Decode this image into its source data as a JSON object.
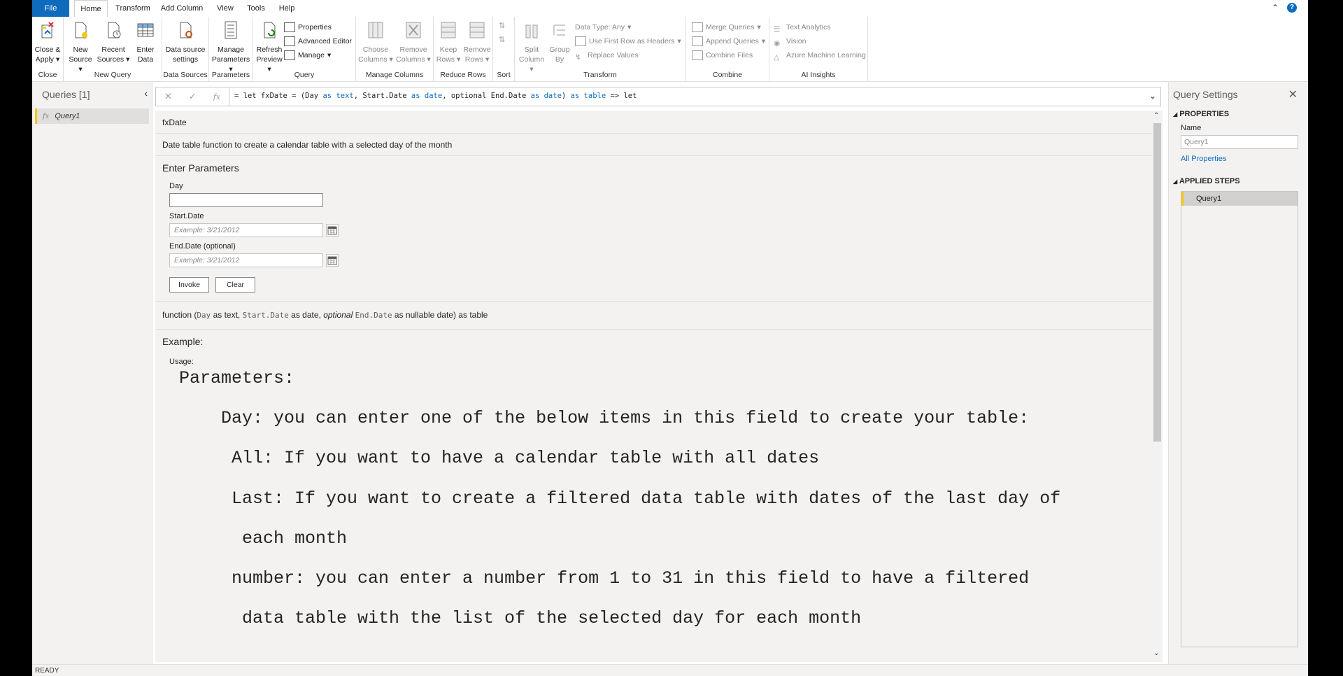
{
  "tabs": [
    "File",
    "Home",
    "Transform",
    "Add Column",
    "View",
    "Tools",
    "Help"
  ],
  "ribbon": {
    "close": {
      "close_apply": [
        "Close &",
        "Apply"
      ],
      "group": "Close"
    },
    "new_query": {
      "new_source": [
        "New",
        "Source"
      ],
      "recent_sources": [
        "Recent",
        "Sources"
      ],
      "enter_data": [
        "Enter",
        "Data"
      ],
      "group": "New Query"
    },
    "data_sources": {
      "settings": [
        "Data source",
        "settings"
      ],
      "group": "Data Sources"
    },
    "parameters": {
      "manage": [
        "Manage",
        "Parameters"
      ],
      "group": "Parameters"
    },
    "query": {
      "refresh": [
        "Refresh",
        "Preview"
      ],
      "properties": "Properties",
      "advanced_editor": "Advanced Editor",
      "manage": "Manage",
      "group": "Query"
    },
    "manage_columns": {
      "choose": [
        "Choose",
        "Columns"
      ],
      "remove": [
        "Remove",
        "Columns"
      ],
      "group": "Manage Columns"
    },
    "reduce_rows": {
      "keep": [
        "Keep",
        "Rows"
      ],
      "remove": [
        "Remove",
        "Rows"
      ],
      "group": "Reduce Rows"
    },
    "sort": {
      "group": "Sort"
    },
    "transform": {
      "split": [
        "Split",
        "Column"
      ],
      "group_by": [
        "Group",
        "By"
      ],
      "data_type": "Data Type: Any",
      "use_first_row": "Use First Row as Headers",
      "replace_values": "Replace Values",
      "group": "Transform"
    },
    "combine": {
      "merge": "Merge Queries",
      "append": "Append Queries",
      "combine_files": "Combine Files",
      "group": "Combine"
    },
    "ai": {
      "text_analytics": "Text Analytics",
      "vision": "Vision",
      "azure_ml": "Azure Machine Learning",
      "group": "AI Insights"
    }
  },
  "queries_pane": {
    "title": "Queries [1]",
    "item": "Query1"
  },
  "formula_bar": {
    "text_parts": [
      "= let fxDate = (Day ",
      "as",
      " ",
      "text",
      ", Start.Date ",
      "as",
      " ",
      "date",
      ", optional End.Date ",
      "as",
      " ",
      "date",
      ") ",
      "as",
      " ",
      "table",
      " => let"
    ]
  },
  "main": {
    "function_name": "fxDate",
    "description": "Date table function to create a calendar table with a selected day of the month",
    "enter_parameters": "Enter Parameters",
    "day_label": "Day",
    "start_label": "Start.Date",
    "start_placeholder": "Example: 3/21/2012",
    "end_label": "End.Date (optional)",
    "end_placeholder": "Example: 3/21/2012",
    "invoke": "Invoke",
    "clear": "Clear",
    "signature": {
      "prefix": "function (",
      "p1": "Day",
      "t1": " as text, ",
      "p2": "Start.Date",
      "t2": " as date, ",
      "opt": "optional",
      "sp": " ",
      "p3": "End.Date",
      "t3": " as nullable date) as table"
    },
    "example": "Example:",
    "usage": "Usage:",
    "usage_lines": [
      "Parameters:",
      "Day: you can enter one of the below items in this field to create your table:",
      "All: If you want to have a calendar table with all dates",
      "Last: If you want to create a filtered data table with dates of the last day of",
      "each month",
      "number: you can enter a number from 1 to 31 in this field to have a filtered",
      "data table with the list of the selected day for each month"
    ]
  },
  "query_settings": {
    "title": "Query Settings",
    "properties": "PROPERTIES",
    "name_label": "Name",
    "name_value": "Query1",
    "all_properties": "All Properties",
    "applied_steps": "APPLIED STEPS",
    "step": "Query1"
  },
  "status": "READY"
}
